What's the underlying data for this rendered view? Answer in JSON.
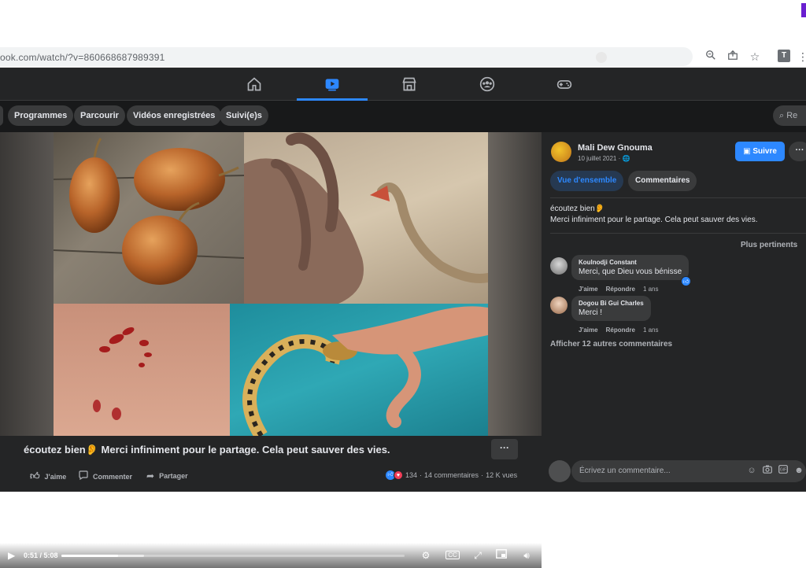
{
  "browser": {
    "url": "ook.com/watch/?v=860668687989391",
    "icons": [
      "zoom-icon",
      "share-icon",
      "star-icon",
      "extension-t-icon",
      "more-icon"
    ],
    "extension_label": "T"
  },
  "fb_nav": {
    "tabs": [
      {
        "name": "home",
        "icon": "home-icon"
      },
      {
        "name": "watch",
        "icon": "play-icon",
        "active": true
      },
      {
        "name": "marketplace",
        "icon": "store-icon"
      },
      {
        "name": "groups",
        "icon": "groups-icon"
      },
      {
        "name": "gaming",
        "icon": "gamepad-icon"
      }
    ],
    "accent": "#2d88ff"
  },
  "subnav": {
    "chips": [
      "Programmes",
      "Parcourir",
      "Vidéos enregistrées",
      "Suivi(e)s"
    ],
    "search_placeholder": "Re"
  },
  "video": {
    "time": "0:51 / 5:08",
    "progress": 0.165,
    "buffered": 0.24,
    "cc_label": "CC"
  },
  "post": {
    "title": "écoutez bien👂 Merci infiniment pour le partage. Cela peut sauver des vies.",
    "more_label": "···",
    "actions": {
      "like": "J'aime",
      "comment": "Commenter",
      "share": "Partager"
    },
    "stats": {
      "reactions": "134",
      "separator1": "·",
      "comments": "14 commentaires",
      "separator2": "·",
      "views": "12 K vues"
    }
  },
  "panel": {
    "author": "Mali Dew Gnouma",
    "date": "10 juillet 2021 · 🌐",
    "follow_label": "Suivre",
    "more_label": "···",
    "tabs": [
      "Vue d'ensemble",
      "Commentaires"
    ],
    "description_line1": "écoutez bien👂",
    "description_line2": "Merci infiniment pour le partage. Cela peut sauver des vies.",
    "sort_label": "Plus pertinents",
    "comments": [
      {
        "author": "Koulnodji Constant",
        "text": "Merci, que Dieu vous bénisse",
        "like": "J'aime",
        "reply": "Répondre",
        "time": "1 ans"
      },
      {
        "author": "Dogou Bi Gui Charles",
        "text": "Merci !",
        "like": "J'aime",
        "reply": "Répondre",
        "time": "1 ans"
      }
    ],
    "more_comments": "Afficher 12 autres commentaires",
    "write_placeholder": "Écrivez un commentaire..."
  }
}
